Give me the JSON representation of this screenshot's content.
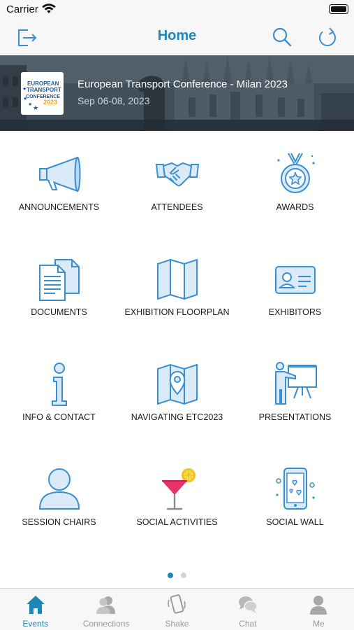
{
  "status_bar": {
    "carrier": "Carrier"
  },
  "header": {
    "title": "Home"
  },
  "event": {
    "title": "European Transport Conference - Milan 2023",
    "dates": "Sep 06-08, 2023",
    "logo_text": [
      "EUROPEAN",
      "TRANSPORT",
      "CONFERENCE",
      "2023"
    ]
  },
  "menu": [
    {
      "label": "ANNOUNCEMENTS",
      "icon": "megaphone-icon"
    },
    {
      "label": "ATTENDEES",
      "icon": "handshake-icon"
    },
    {
      "label": "AWARDS",
      "icon": "medal-icon"
    },
    {
      "label": "DOCUMENTS",
      "icon": "documents-icon"
    },
    {
      "label": "EXHIBITION FLOORPLAN",
      "icon": "floorplan-map-icon"
    },
    {
      "label": "EXHIBITORS",
      "icon": "id-card-icon"
    },
    {
      "label": "INFO & CONTACT",
      "icon": "info-icon"
    },
    {
      "label": "NAVIGATING ETC2023",
      "icon": "map-pin-icon"
    },
    {
      "label": "PRESENTATIONS",
      "icon": "presenter-board-icon"
    },
    {
      "label": "SESSION CHAIRS",
      "icon": "person-icon"
    },
    {
      "label": "SOCIAL ACTIVITIES",
      "icon": "cocktail-icon"
    },
    {
      "label": "SOCIAL WALL",
      "icon": "phone-hearts-icon"
    }
  ],
  "pagination": {
    "current_page": 1,
    "total_pages": 2
  },
  "tabs": [
    {
      "label": "Events",
      "icon": "home-icon",
      "active": true
    },
    {
      "label": "Connections",
      "icon": "people-icon",
      "active": false
    },
    {
      "label": "Shake",
      "icon": "shake-phone-icon",
      "active": false
    },
    {
      "label": "Chat",
      "icon": "chat-bubbles-icon",
      "active": false
    },
    {
      "label": "Me",
      "icon": "user-icon",
      "active": false
    }
  ],
  "colors": {
    "accent": "#1f86b8",
    "icon_stroke": "#3a8fd1",
    "icon_fill": "#dbeaf8",
    "tab_inactive": "#9a9a9a",
    "dot_inactive": "#d3d3d3",
    "cocktail_pink": "#e6336b",
    "lime": "#f4c21b"
  }
}
